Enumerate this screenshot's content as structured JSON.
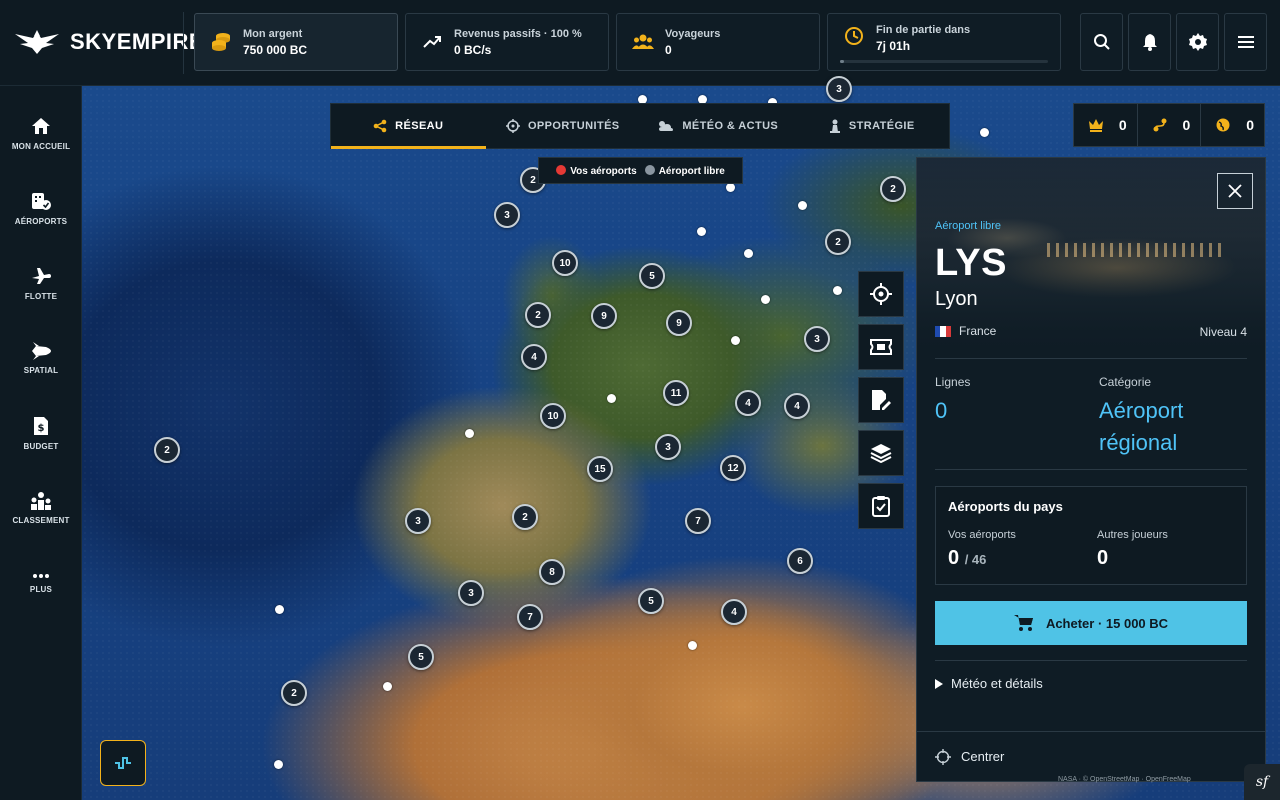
{
  "app": {
    "name": "SKYEMPIRE"
  },
  "stats": {
    "money": {
      "label": "Mon argent",
      "value": "750 000 BC"
    },
    "income": {
      "label": "Revenus passifs · 100 %",
      "value": "0 BC/s"
    },
    "travelers": {
      "label": "Voyageurs",
      "value": "0"
    },
    "endgame": {
      "label": "Fin de partie dans",
      "value": "7j 01h",
      "progress": 0.02
    }
  },
  "sidebar": {
    "items": [
      {
        "label": "MON ACCUEIL",
        "icon": "home-icon"
      },
      {
        "label": "AÉROPORTS",
        "icon": "airport-icon"
      },
      {
        "label": "FLOTTE",
        "icon": "plane-icon"
      },
      {
        "label": "SPATIAL",
        "icon": "shuttle-icon"
      },
      {
        "label": "BUDGET",
        "icon": "budget-icon"
      },
      {
        "label": "CLASSEMENT",
        "icon": "ranking-icon"
      },
      {
        "label": "PLUS",
        "icon": "more-icon"
      }
    ]
  },
  "tabs": [
    {
      "label": "RÉSEAU",
      "icon": "share-icon",
      "active": true
    },
    {
      "label": "OPPORTUNITÉS",
      "icon": "target-icon",
      "active": false
    },
    {
      "label": "MÉTÉO & ACTUS",
      "icon": "weather-icon",
      "active": false
    },
    {
      "label": "STRATÉGIE",
      "icon": "chess-icon",
      "active": false
    }
  ],
  "legend": {
    "mine": "Vos aéroports",
    "free": "Aéroport libre",
    "mine_color": "#e53935",
    "free_color": "#8a96a0"
  },
  "counters": [
    "0",
    "0",
    "0"
  ],
  "clusters": [
    "2",
    "2",
    "3",
    "10",
    "5",
    "2",
    "9",
    "9",
    "2",
    "4",
    "10",
    "11",
    "3",
    "4",
    "4",
    "15",
    "12",
    "3",
    "2",
    "2",
    "3",
    "8",
    "3",
    "7",
    "5",
    "4",
    "6",
    "5",
    "2",
    "7",
    "3"
  ],
  "panel": {
    "subtitle": "Aéroport libre",
    "code": "LYS",
    "city": "Lyon",
    "country": "France",
    "level": "Niveau 4",
    "lines_label": "Lignes",
    "lines_value": "0",
    "category_label": "Catégorie",
    "category_value_1": "Aéroport",
    "category_value_2": "régional",
    "country_box": {
      "title": "Aéroports du pays",
      "yours_label": "Vos aéroports",
      "yours_value": "0",
      "yours_total": "/ 46",
      "others_label": "Autres joueurs",
      "others_value": "0"
    },
    "buy_label": "Acheter · 15 000 BC",
    "details_label": "Météo et détails",
    "center_label": "Centrer"
  },
  "attribution": "NASA · © OpenStreetMap · OpenFreeMap",
  "colors": {
    "accent": "#f2b21b",
    "primary": "#4fc3e6",
    "bg": "#0e1a22"
  }
}
